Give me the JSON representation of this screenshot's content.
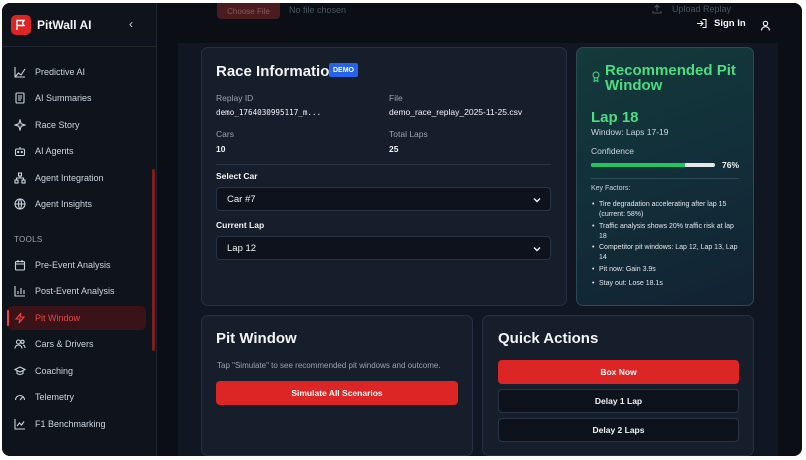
{
  "app": {
    "name": "PitWall AI"
  },
  "header": {
    "choose_file": "Choose File",
    "no_file": "No file chosen",
    "upload_replay": "Upload Replay",
    "sign_in": "Sign In"
  },
  "sidebar": {
    "items_top": [
      {
        "label": "Predictive AI",
        "icon": "trend-icon"
      },
      {
        "label": "AI Summaries",
        "icon": "document-icon"
      },
      {
        "label": "Race Story",
        "icon": "sparkle-icon"
      },
      {
        "label": "AI Agents",
        "icon": "bot-icon"
      },
      {
        "label": "Agent Integration",
        "icon": "network-icon"
      },
      {
        "label": "Agent Insights",
        "icon": "globe-icon"
      }
    ],
    "tools_label": "TOOLS",
    "items_tools": [
      {
        "label": "Pre-Event Analysis",
        "icon": "calendar-icon"
      },
      {
        "label": "Post-Event Analysis",
        "icon": "bar-chart-icon"
      },
      {
        "label": "Pit Window",
        "icon": "bolt-icon",
        "active": true
      },
      {
        "label": "Cars & Drivers",
        "icon": "people-icon"
      },
      {
        "label": "Coaching",
        "icon": "graduation-icon"
      },
      {
        "label": "Telemetry",
        "icon": "gauge-icon"
      },
      {
        "label": "F1 Benchmarking",
        "icon": "chart-line-icon"
      }
    ]
  },
  "race_info": {
    "title": "Race Information",
    "badge": "DEMO",
    "replay_id_label": "Replay ID",
    "replay_id": "demo_1764030995117_m...",
    "file_label": "File",
    "file": "demo_race_replay_2025-11-25.csv",
    "cars_label": "Cars",
    "cars": "10",
    "total_laps_label": "Total Laps",
    "total_laps": "25",
    "select_car_label": "Select Car",
    "selected_car": "Car #7",
    "current_lap_label": "Current Lap",
    "current_lap": "Lap 12"
  },
  "recommended": {
    "title": "Recommended Pit Window",
    "lap": "Lap 18",
    "window": "Window: Laps 17-19",
    "confidence_label": "Confidence",
    "confidence_value": "76%",
    "confidence_fraction": 0.76,
    "key_factors_label": "Key Factors:",
    "factors": [
      "Tire degradation accelerating after lap 15 (current: 58%)",
      "Traffic analysis shows 20% traffic risk at lap 18",
      "Competitor pit windows: Lap 12, Lap 13, Lap 14",
      "Pit now: Gain 3.9s",
      "Stay out: Lose 18.1s"
    ]
  },
  "pit_window": {
    "title": "Pit Window",
    "description": "Tap \"Simulate\" to see recommended pit windows and outcome.",
    "simulate_button": "Simulate All Scenarios"
  },
  "quick_actions": {
    "title": "Quick Actions",
    "box_now": "Box Now",
    "delay_1": "Delay 1 Lap",
    "delay_2": "Delay 2 Laps"
  },
  "colors": {
    "accent_red": "#dc2626",
    "accent_green": "#4ade80",
    "badge_blue": "#2563eb"
  }
}
